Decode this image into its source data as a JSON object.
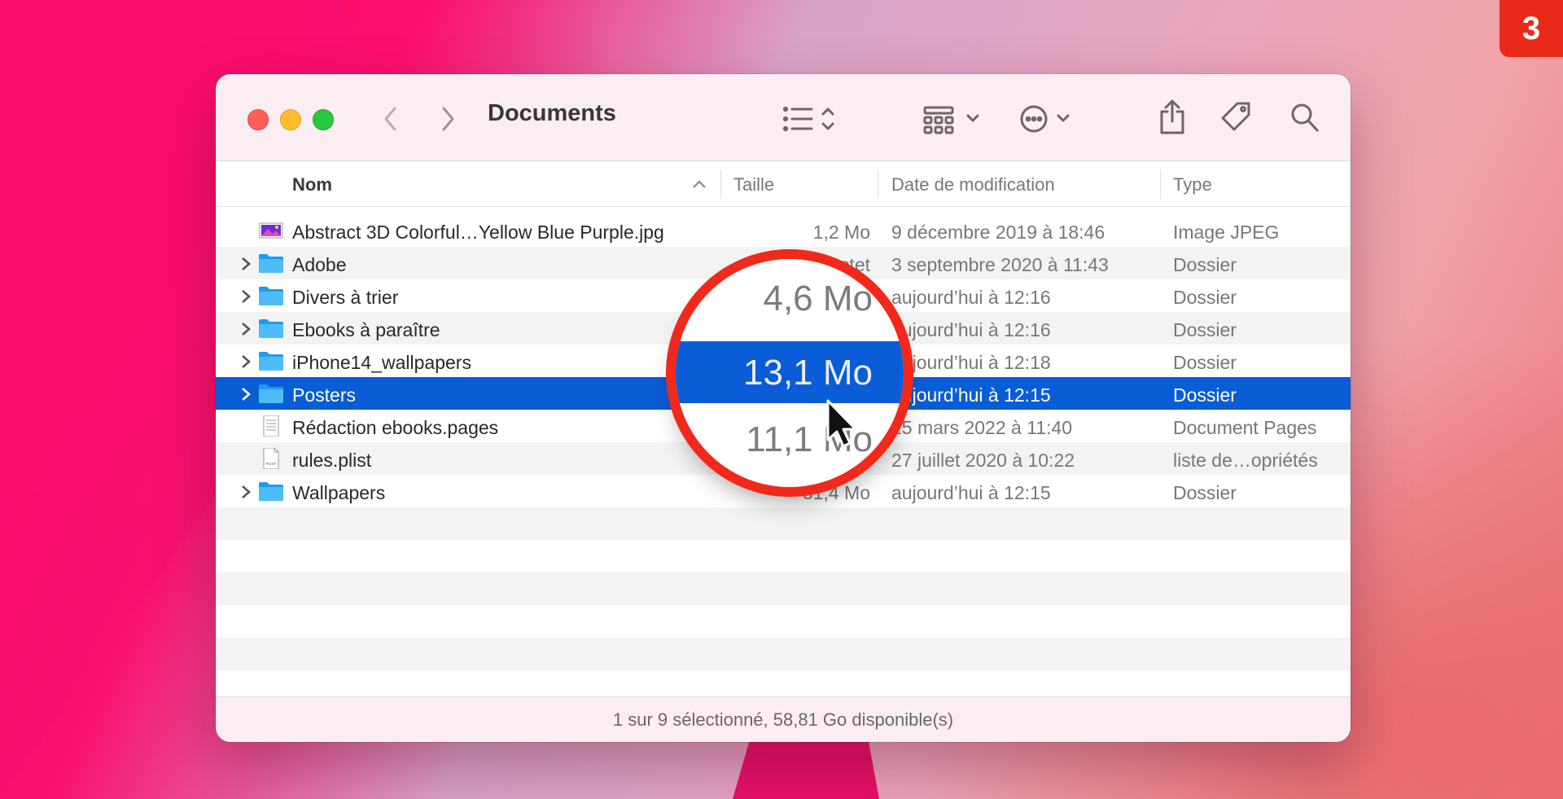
{
  "badge": "3",
  "window": {
    "title": "Documents",
    "columns": {
      "name": "Nom",
      "size": "Taille",
      "date": "Date de modification",
      "type": "Type"
    },
    "rows": [
      {
        "name": "Abstract 3D Colorful…Yellow Blue Purple.jpg",
        "size": "1,2 Mo",
        "date": "9 décembre 2019 à 18:46",
        "type": "Image JPEG",
        "icon": "image-icon",
        "folder": false
      },
      {
        "name": "Adobe",
        "size": "7… octet",
        "date": "3 septembre 2020 à 11:43",
        "type": "Dossier",
        "icon": "folder-icon",
        "folder": true
      },
      {
        "name": "Divers à trier",
        "size": "",
        "date": "aujourd’hui à 12:16",
        "type": "Dossier",
        "icon": "folder-icon",
        "folder": true
      },
      {
        "name": "Ebooks à paraître",
        "size": "",
        "date": "aujourd’hui à 12:16",
        "type": "Dossier",
        "icon": "folder-icon",
        "folder": true
      },
      {
        "name": "iPhone14_wallpapers",
        "size": "",
        "date": "aujourd’hui à 12:18",
        "type": "Dossier",
        "icon": "folder-icon",
        "folder": true
      },
      {
        "name": "Posters",
        "size": "",
        "date": "aujourd’hui à 12:15",
        "type": "Dossier",
        "icon": "folder-icon",
        "folder": true,
        "selected": true
      },
      {
        "name": "Rédaction ebooks.pages",
        "size": "",
        "date": "15 mars 2022 à 11:40",
        "type": "Document Pages",
        "icon": "pages-doc-icon",
        "folder": false
      },
      {
        "name": "rules.plist",
        "size": "",
        "date": "27 juillet 2020 à 10:22",
        "type": "liste de…opriétés",
        "icon": "plist-icon",
        "folder": false
      },
      {
        "name": "Wallpapers",
        "size": "31,4 Mo",
        "date": "aujourd’hui à 12:15",
        "type": "Dossier",
        "icon": "folder-icon",
        "folder": true
      }
    ],
    "status": "1 sur 9 sélectionné, 58,81 Go disponible(s)"
  },
  "magnifier": {
    "above": "4,6 Mo",
    "selected": "13,1 Mo",
    "below": "11,1 Mo"
  },
  "colors": {
    "selection": "#0a5cd7",
    "highlight_ring": "#f0291a",
    "folder": "#3fb2f2"
  }
}
